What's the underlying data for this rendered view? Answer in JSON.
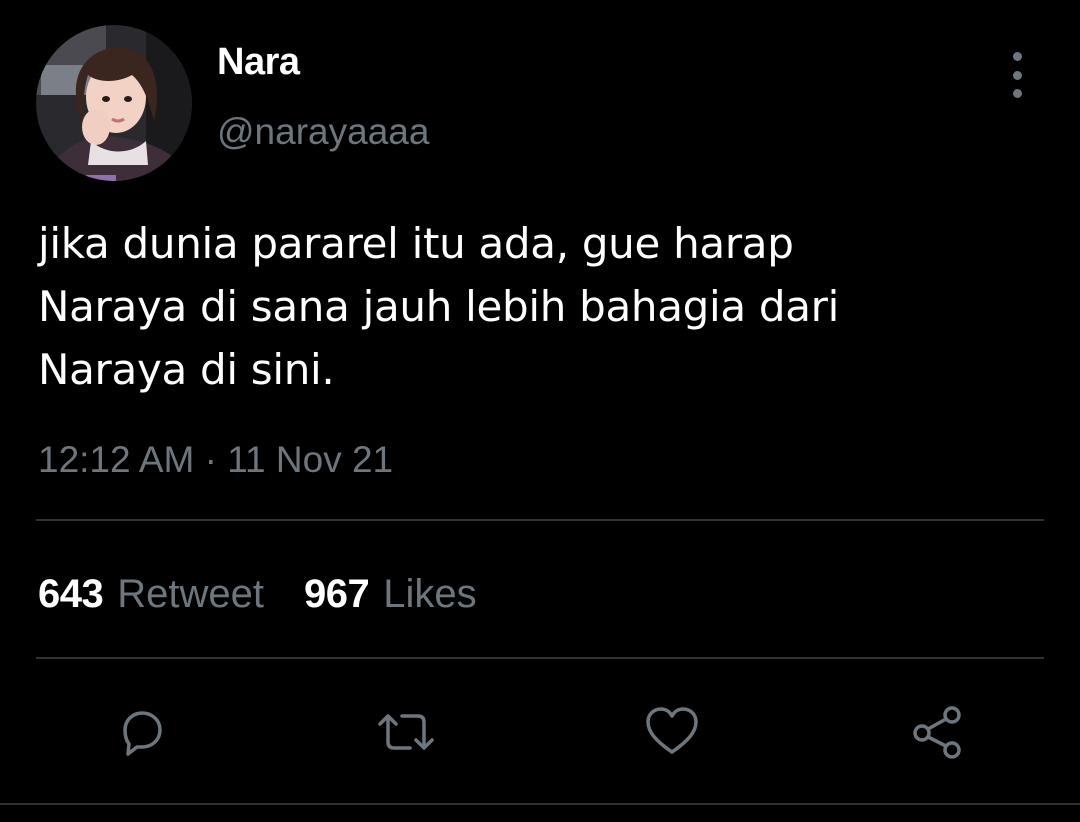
{
  "tweet": {
    "author": {
      "display_name": "Nara",
      "handle": "@narayaaaa"
    },
    "text": "jika dunia pararel itu ada, gue harap\nNaraya di sana jauh lebih bahagia dari\nNaraya di sini.",
    "timestamp": "12:12 AM · 11 Nov 21",
    "stats": {
      "retweets": "643",
      "retweets_label": "Retweet",
      "likes": "967",
      "likes_label": "Likes"
    },
    "actions": [
      "reply-icon",
      "retweet-icon",
      "like-icon",
      "share-icon"
    ]
  },
  "colors": {
    "background": "#000000",
    "text": "#ffffff",
    "secondary": "#6e767d",
    "divider": "#2f3336"
  }
}
